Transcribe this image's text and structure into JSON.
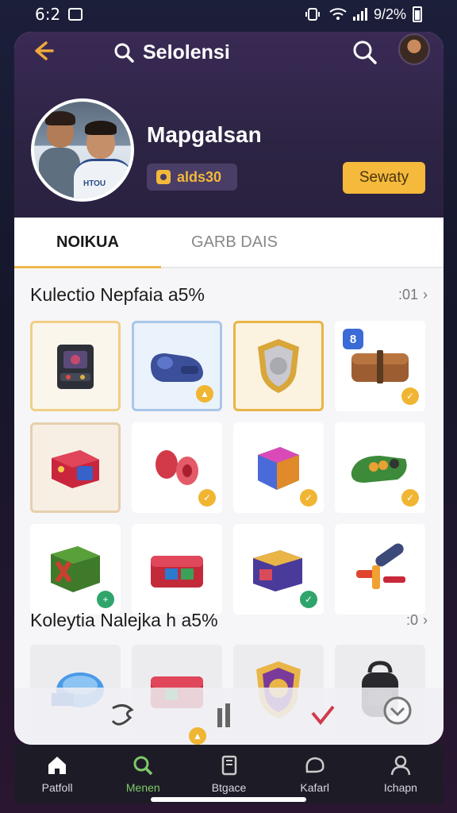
{
  "status_bar": {
    "time": "6:2",
    "battery": "9/2%"
  },
  "header": {
    "search_title": "Selolensi",
    "profile_name": "Mapgalsan",
    "badge_text": "alds30",
    "action_button": "Sewaty",
    "photo_jersey": "HTOU"
  },
  "tabs": [
    {
      "label": "NOIKUA",
      "active": true
    },
    {
      "label": "GARB DAIS",
      "active": false
    }
  ],
  "sections": [
    {
      "title": "Kulectio Nepfaia a5%",
      "more": ":01"
    },
    {
      "title": "Koleytia Nalejka h a5%",
      "more": ":0"
    }
  ],
  "grid1": [
    {
      "icon": "arcade-machine-icon",
      "badge": "",
      "mini": ""
    },
    {
      "icon": "blue-gadget-icon",
      "badge": "",
      "mini": "gold"
    },
    {
      "icon": "shield-icon",
      "badge": "",
      "mini": ""
    },
    {
      "icon": "leather-case-icon",
      "badge": "8",
      "mini": "gold"
    },
    {
      "icon": "red-box-icon",
      "badge": "",
      "mini": ""
    },
    {
      "icon": "red-spool-icon",
      "badge": "",
      "mini": "gold"
    },
    {
      "icon": "color-cube-icon",
      "badge": "",
      "mini": "gold"
    },
    {
      "icon": "green-tray-icon",
      "badge": "",
      "mini": "gold"
    },
    {
      "icon": "green-crate-icon",
      "badge": "",
      "mini": "green-plus"
    },
    {
      "icon": "red-chest-icon",
      "badge": "",
      "mini": ""
    },
    {
      "icon": "purple-chest-icon",
      "badge": "",
      "mini": "green"
    },
    {
      "icon": "pipe-tool-icon",
      "badge": "",
      "mini": ""
    }
  ],
  "grid2": [
    {
      "icon": "blue-capsule-icon"
    },
    {
      "icon": "red-chest-icon"
    },
    {
      "icon": "lion-shield-icon"
    },
    {
      "icon": "backpack-icon"
    }
  ],
  "bottom_nav": [
    {
      "label": "Patfoll",
      "icon": "home-icon",
      "active": false
    },
    {
      "label": "Menen",
      "icon": "search-icon",
      "active": true
    },
    {
      "label": "Btgace",
      "icon": "book-icon",
      "active": false
    },
    {
      "label": "Kafarl",
      "icon": "chat-icon",
      "active": false
    },
    {
      "label": "Ichapn",
      "icon": "person-icon",
      "active": false
    }
  ],
  "colors": {
    "accent": "#f5b93c",
    "header": "#2d2444",
    "nav_active": "#7fc96a"
  }
}
